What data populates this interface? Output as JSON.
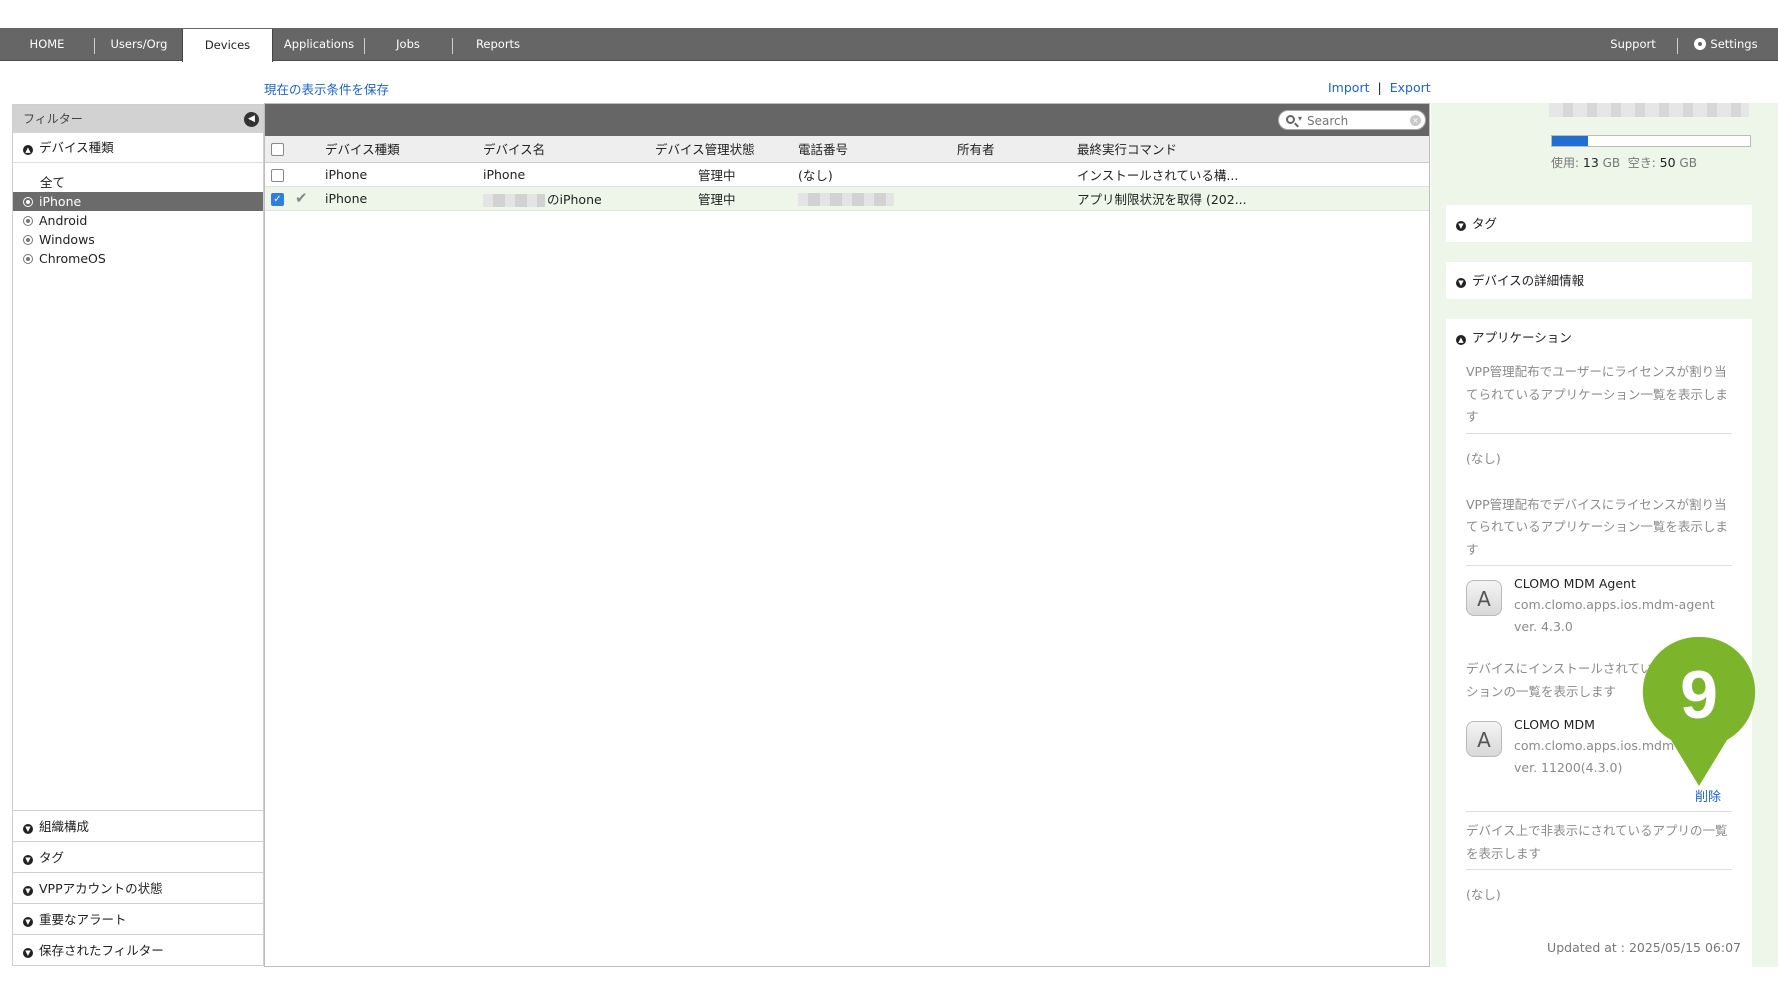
{
  "nav": {
    "tabs": [
      "HOME",
      "Users/Org",
      "Devices",
      "Applications",
      "Jobs",
      "Reports"
    ],
    "active_tab": "Devices",
    "support": "Support",
    "settings": "Settings"
  },
  "actions": {
    "save_view": "現在の表示条件を保存",
    "import": "Import",
    "separator": "|",
    "export": "Export"
  },
  "filter": {
    "title": "フィルター",
    "device_type_section": "デバイス種類",
    "device_types": [
      "全て",
      "iPhone",
      "Android",
      "Windows",
      "ChromeOS"
    ],
    "selected_device_type": "iPhone",
    "bottom_sections": [
      "組織構成",
      "タグ",
      "VPPアカウントの状態",
      "重要なアラート",
      "保存されたフィルター"
    ]
  },
  "table": {
    "search_placeholder": "Search",
    "columns": [
      "デバイス種類",
      "デバイス名",
      "デバイス管理状態",
      "電話番号",
      "所有者",
      "最終実行コマンド"
    ],
    "rows": [
      {
        "checked": false,
        "device_type": "iPhone",
        "device_name": "iPhone",
        "status": "管理中",
        "phone": "(なし)",
        "owner": "",
        "last_command": "インストールされている構..."
      },
      {
        "checked": true,
        "device_type": "iPhone",
        "device_name": "のiPhone",
        "status": "管理中",
        "phone": "",
        "owner": "",
        "last_command": "アプリ制限状況を取得 (202..."
      }
    ]
  },
  "detail": {
    "storage": {
      "used_label": "使用:",
      "used_value": "13",
      "used_unit": "GB",
      "free_label": "空き:",
      "free_value": "50",
      "free_unit": "GB",
      "used_fraction": 0.18
    },
    "sections": {
      "tags": "タグ",
      "device_details": "デバイスの詳細情報",
      "applications": "アプリケーション"
    },
    "apps": {
      "user_vpp_desc": "VPP管理配布でユーザーにライセンスが割り当てられているアプリケーション一覧を表示します",
      "user_vpp_none": "(なし)",
      "device_vpp_desc": "VPP管理配布でデバイスにライセンスが割り当てられているアプリケーション一覧を表示します",
      "device_vpp_app": {
        "name": "CLOMO MDM Agent",
        "bundle_id": "com.clomo.apps.ios.mdm-agent",
        "version": "ver. 4.3.0"
      },
      "installed_desc": "デバイスにインストールされているアプリケーションの一覧を表示します",
      "installed_app": {
        "name": "CLOMO MDM",
        "bundle_id": "com.clomo.apps.ios.mdm-agent",
        "version": "ver. 11200(4.3.0)"
      },
      "delete": "削除",
      "hidden_desc": "デバイス上で非表示にされているアプリの一覧を表示します",
      "hidden_none": "(なし)"
    },
    "updated_at": "Updated at : 2025/05/15 06:07"
  },
  "callout": {
    "number": "9",
    "color": "#7cb52c"
  }
}
